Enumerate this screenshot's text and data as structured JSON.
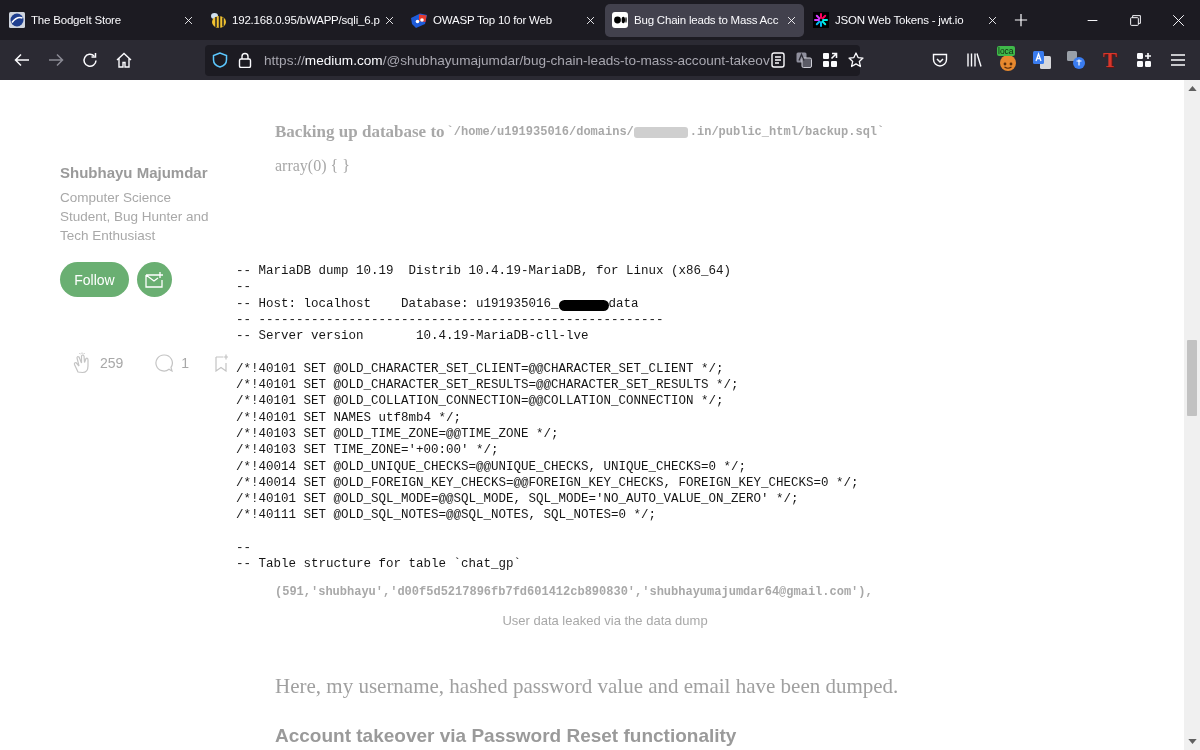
{
  "tabs": [
    {
      "kind": "globe",
      "title": "The BodgeIt Store",
      "selected": false
    },
    {
      "kind": "bee",
      "title": "192.168.0.95/bWAPP/sqli_6.p",
      "selected": false
    },
    {
      "kind": "shield-face",
      "title": "OWASP Top 10 for Web",
      "selected": false
    },
    {
      "kind": "dots",
      "title": "Bug Chain leads to Mass Acc",
      "selected": true
    },
    {
      "kind": "burst",
      "title": "JSON Web Tokens - jwt.io",
      "selected": false
    }
  ],
  "nav_buttons": [
    {
      "kind": "back",
      "disabled": false
    },
    {
      "kind": "forward",
      "disabled": true
    },
    {
      "kind": "reload",
      "disabled": false
    },
    {
      "kind": "home",
      "disabled": false
    }
  ],
  "address_bar": {
    "scheme": "https://",
    "host": "medium.com",
    "path": "/@shubhayumajumdar/bug-chain-leads-to-mass-account-takeov"
  },
  "address_actions": [
    {
      "kind": "reader"
    },
    {
      "kind": "translate"
    },
    {
      "kind": "grid"
    },
    {
      "kind": "star"
    }
  ],
  "toolbar_items": [
    {
      "kind": "pocket"
    },
    {
      "kind": "library"
    },
    {
      "kind": "badge",
      "text": "loca"
    },
    {
      "kind": "translate"
    },
    {
      "kind": "translate-kana"
    },
    {
      "kind": "letter",
      "text": "T"
    },
    {
      "kind": "extensions"
    },
    {
      "kind": "menu"
    }
  ],
  "sidebar": {
    "author": "Shubhayu Majumdar",
    "bio": "Computer Science Student, Bug Hunter and Tech Enthusiast",
    "follow_button": "Follow",
    "claps": "259",
    "comments": "1"
  },
  "article": {
    "backup_line": {
      "lead": "Backing up database to",
      "path_before": "`/home/u191935016/domains/",
      "path_after": ".in/public_html/backup.sql`"
    },
    "array_line": "array(0) { }",
    "data_row": "(591,'shubhayu','d00f5d5217896fb7fd601412cb890830','shubhayumajumdar64@gmail.com'),",
    "caption": "User data leaked via the data dump",
    "paragraph": "Here, my username, hashed password value and email have been dumped.",
    "heading": "Account takeover via Password Reset functionality"
  },
  "zoomed_image": {
    "lines": [
      {
        "kind": "text",
        "text": "-- MariaDB dump 10.19  Distrib 10.4.19-MariaDB, for Linux (x86_64)"
      },
      {
        "kind": "text",
        "text": "--"
      },
      {
        "kind": "redacted",
        "before": "-- Host: localhost    Database: u191935016_",
        "after": "data"
      },
      {
        "kind": "text",
        "text": "-- ------------------------------------------------------"
      },
      {
        "kind": "text",
        "text": "-- Server version       10.4.19-MariaDB-cll-lve"
      },
      {
        "kind": "blank"
      },
      {
        "kind": "text",
        "text": "/*!40101 SET @OLD_CHARACTER_SET_CLIENT=@@CHARACTER_SET_CLIENT */;"
      },
      {
        "kind": "text",
        "text": "/*!40101 SET @OLD_CHARACTER_SET_RESULTS=@@CHARACTER_SET_RESULTS */;"
      },
      {
        "kind": "text",
        "text": "/*!40101 SET @OLD_COLLATION_CONNECTION=@@COLLATION_CONNECTION */;"
      },
      {
        "kind": "text",
        "text": "/*!40101 SET NAMES utf8mb4 */;"
      },
      {
        "kind": "text",
        "text": "/*!40103 SET @OLD_TIME_ZONE=@@TIME_ZONE */;"
      },
      {
        "kind": "text",
        "text": "/*!40103 SET TIME_ZONE='+00:00' */;"
      },
      {
        "kind": "text",
        "text": "/*!40014 SET @OLD_UNIQUE_CHECKS=@@UNIQUE_CHECKS, UNIQUE_CHECKS=0 */;"
      },
      {
        "kind": "text",
        "text": "/*!40014 SET @OLD_FOREIGN_KEY_CHECKS=@@FOREIGN_KEY_CHECKS, FOREIGN_KEY_CHECKS=0 */;"
      },
      {
        "kind": "text",
        "text": "/*!40101 SET @OLD_SQL_MODE=@@SQL_MODE, SQL_MODE='NO_AUTO_VALUE_ON_ZERO' */;"
      },
      {
        "kind": "text",
        "text": "/*!40111 SET @OLD_SQL_NOTES=@@SQL_NOTES, SQL_NOTES=0 */;"
      },
      {
        "kind": "blank"
      },
      {
        "kind": "text",
        "text": "--"
      },
      {
        "kind": "text",
        "text": "-- Table structure for table `chat_gp`"
      }
    ]
  }
}
